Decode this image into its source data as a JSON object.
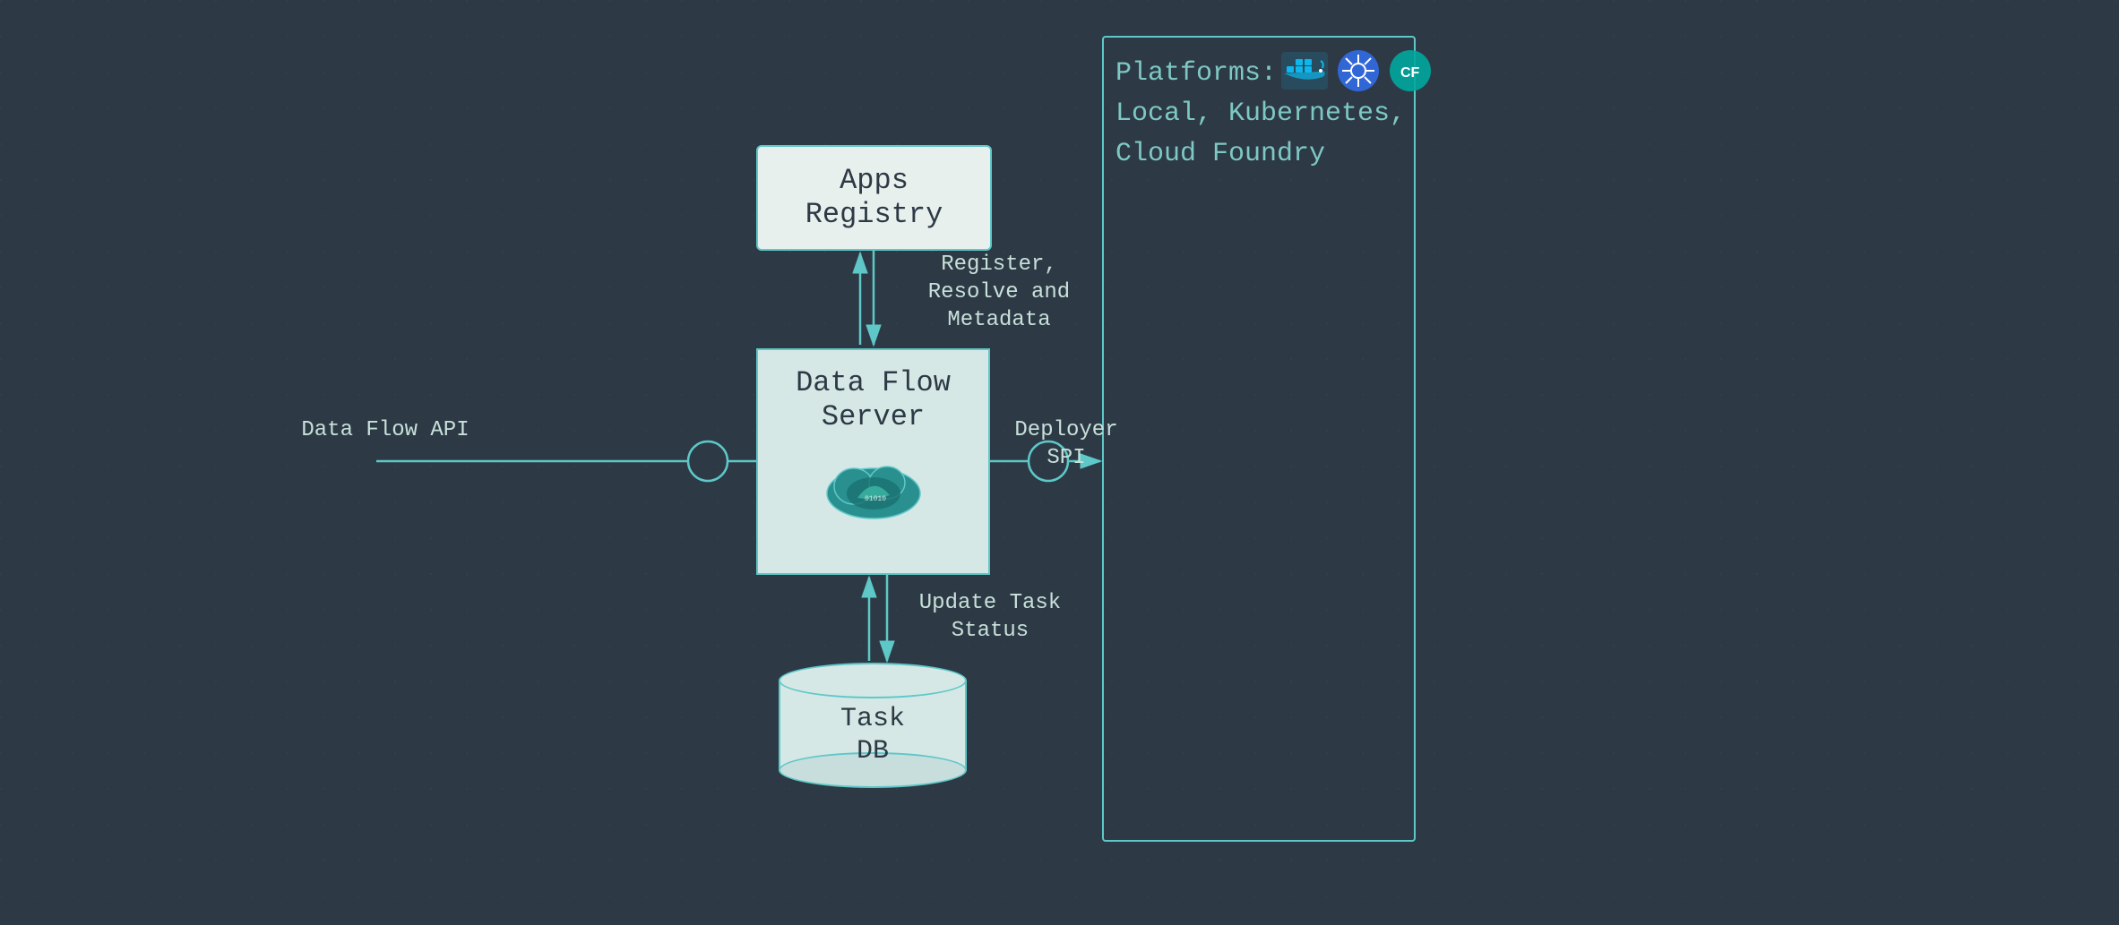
{
  "diagram": {
    "background_color": "#2d3a45",
    "accent_color": "#5ec8c8",
    "nodes": {
      "apps_registry": {
        "label_line1": "Apps",
        "label_line2": "Registry"
      },
      "data_flow_server": {
        "label_line1": "Data Flow",
        "label_line2": "Server"
      },
      "task_db": {
        "label_line1": "Task",
        "label_line2": "DB"
      }
    },
    "connections": {
      "register_resolve": "Register, Resolve and\nMetadata",
      "data_flow_api": "Data Flow API",
      "deployer_spi": "Deployer SPI",
      "update_task": "Update Task\nStatus"
    },
    "platforms": {
      "title": "Platforms:",
      "items": "Local, Kubernetes,\nCloud Foundry"
    }
  }
}
